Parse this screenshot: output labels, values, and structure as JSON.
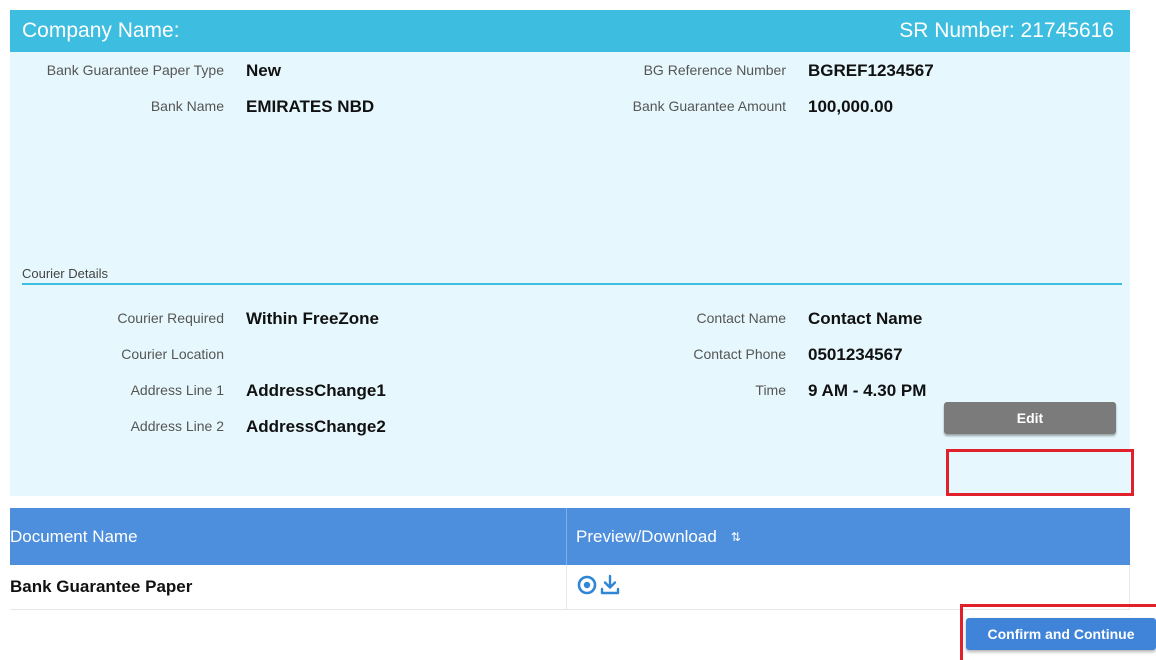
{
  "header": {
    "company_label": "Company Name:",
    "sr_number": "SR Number: 21745616",
    "color": "#3dbde0"
  },
  "guarantee": {
    "paper_type": {
      "label": "Bank Guarantee Paper Type",
      "value": "New"
    },
    "bg_reference": {
      "label": "BG Reference Number",
      "value": "BGREF1234567"
    },
    "bank_name": {
      "label": "Bank Name",
      "value": "EMIRATES NBD"
    },
    "amount": {
      "label": "Bank Guarantee Amount",
      "value": "100,000.00"
    }
  },
  "courier": {
    "section_title": "Courier Details",
    "required": {
      "label": "Courier Required",
      "value": "Within FreeZone"
    },
    "location": {
      "label": "Courier Location",
      "value": ""
    },
    "address1": {
      "label": "Address Line 1",
      "value": "AddressChange1"
    },
    "address2": {
      "label": "Address Line 2",
      "value": "AddressChange2"
    },
    "contact_name": {
      "label": "Contact Name",
      "value": "Contact Name"
    },
    "contact_phone": {
      "label": "Contact Phone",
      "value": "0501234567"
    },
    "time": {
      "label": "Time",
      "value": "9 AM - 4.30 PM"
    }
  },
  "actions": {
    "edit_label": "Edit",
    "confirm_label": "Confirm and Continue"
  },
  "documents": {
    "headers": [
      "Document Name",
      "Preview/Download"
    ],
    "sort_icon": "⇅",
    "rows": [
      {
        "name": "Bank Guarantee Paper",
        "icons": [
          "eye-icon",
          "download-icon"
        ]
      }
    ],
    "header_color": "#4d8fdd"
  },
  "highlight_color": "#e0202a"
}
